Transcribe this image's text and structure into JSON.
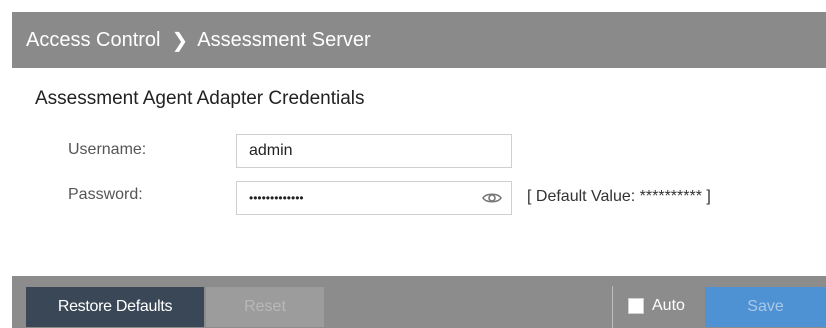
{
  "header": {
    "crumb_parent": "Access Control",
    "crumb_separator": "❯",
    "crumb_current": "Assessment Server"
  },
  "section": {
    "title": "Assessment Agent Adapter Credentials"
  },
  "form": {
    "username_label": "Username:",
    "username_value": "admin",
    "password_label": "Password:",
    "password_value": "•••••••••••••",
    "default_hint": "[ Default Value: ********** ]",
    "show_password_icon": "eye-icon"
  },
  "footer": {
    "restore_label": "Restore Defaults",
    "reset_label": "Reset",
    "auto_label": "Auto",
    "auto_checked": false,
    "save_label": "Save"
  },
  "colors": {
    "header_bg": "#8a8a8a",
    "footer_bg": "#8c8c8c",
    "restore_bg": "#3a4756",
    "save_bg": "#4f92d3"
  }
}
